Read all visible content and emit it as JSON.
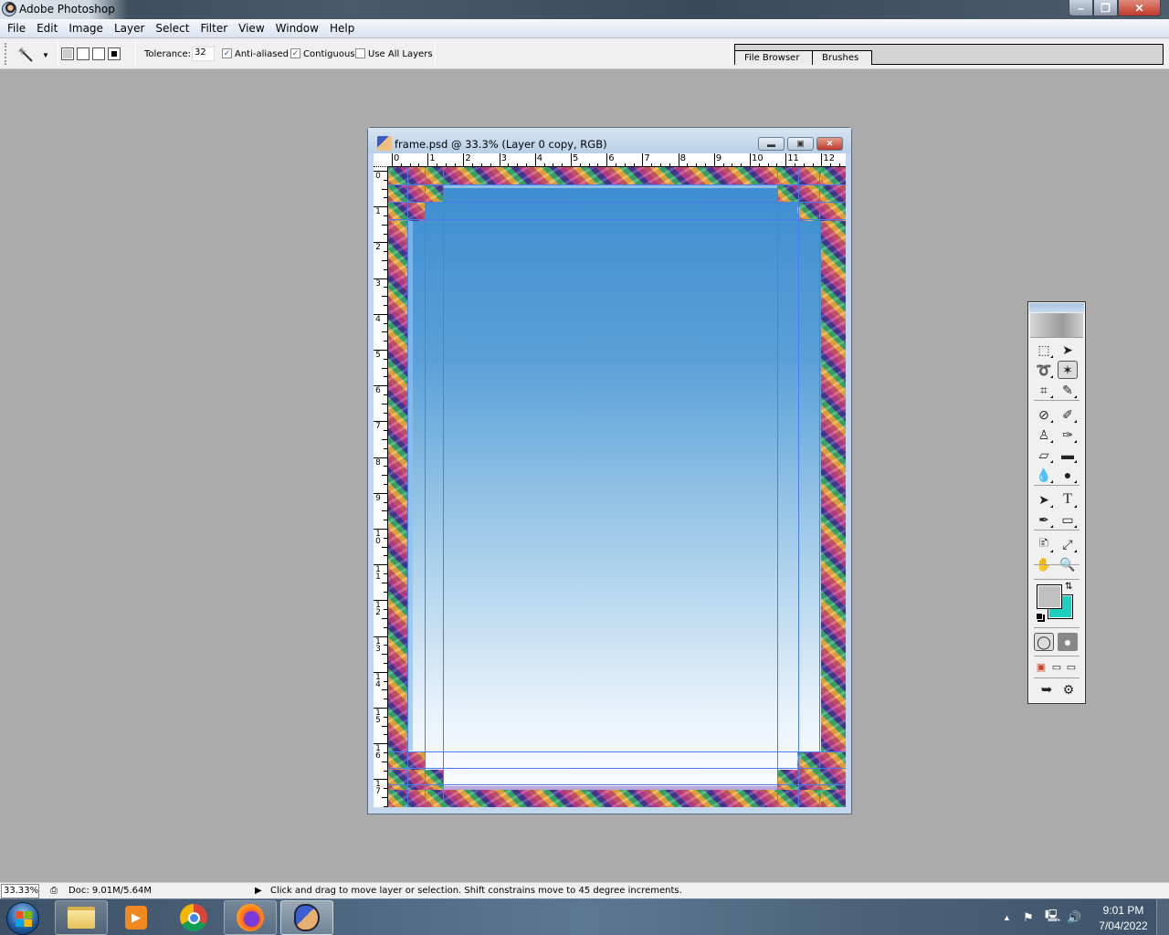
{
  "app": {
    "title": "Adobe Photoshop",
    "window_controls": {
      "minimize": "–",
      "maximize": "❐",
      "close": "✕"
    }
  },
  "menu": [
    "File",
    "Edit",
    "Image",
    "Layer",
    "Select",
    "Filter",
    "View",
    "Window",
    "Help"
  ],
  "options_bar": {
    "current_tool_icon": "magic-wand-icon",
    "tolerance_label": "Tolerance:",
    "tolerance_value": "32",
    "anti_aliased": {
      "label": "Anti-aliased",
      "checked": true
    },
    "contiguous": {
      "label": "Contiguous",
      "checked": true
    },
    "use_all_layers": {
      "label": "Use All Layers",
      "checked": false
    },
    "selection_modes": [
      "new-selection",
      "add-to-selection",
      "subtract-from-selection",
      "intersect-selection"
    ]
  },
  "palette_well": {
    "tabs": [
      "File Browser",
      "Brushes"
    ]
  },
  "document": {
    "title": "frame.psd @ 33.3% (Layer 0 copy, RGB)",
    "ruler_h": [
      "0",
      "1",
      "2",
      "3",
      "4",
      "5",
      "6",
      "7",
      "8",
      "9",
      "10",
      "11",
      "12"
    ],
    "ruler_v": [
      "0",
      "1",
      "2",
      "3",
      "4",
      "5",
      "6",
      "7",
      "8",
      "9",
      "10",
      "11",
      "12",
      "13",
      "14",
      "15",
      "16",
      "17"
    ],
    "canvas_colors": {
      "top": "#3a8ccf",
      "bottom": "#ffffff",
      "guide": "#4a7ef0"
    }
  },
  "toolbox": {
    "tools": [
      [
        "rectangular-marquee",
        "move"
      ],
      [
        "lasso",
        "magic-wand"
      ],
      [
        "crop",
        "slice"
      ],
      [
        "healing-brush",
        "brush"
      ],
      [
        "clone-stamp",
        "history-brush"
      ],
      [
        "eraser",
        "gradient"
      ],
      [
        "blur",
        "dodge"
      ],
      [
        "path-selection",
        "type"
      ],
      [
        "pen",
        "shape"
      ],
      [
        "notes",
        "eyedropper"
      ],
      [
        "hand",
        "zoom"
      ]
    ],
    "active_tool": "magic-wand",
    "foreground_color": "#c0c0c0",
    "background_color": "#1ecfc0"
  },
  "status_bar": {
    "zoom": "33.33%",
    "doc_size": "Doc: 9.01M/5.64M",
    "hint": "Click and drag to move layer or selection. Shift constrains move to 45 degree increments."
  },
  "taskbar": {
    "apps": [
      "file-explorer",
      "media-player",
      "chrome",
      "firefox",
      "photoshop"
    ],
    "time": "9:01 PM",
    "date": "7/04/2022"
  }
}
